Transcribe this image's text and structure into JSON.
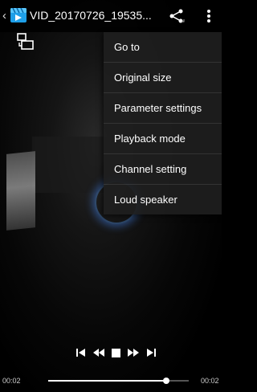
{
  "header": {
    "back_glyph": "‹",
    "title": "VID_20170726_19535..."
  },
  "menu": {
    "items": [
      "Go to",
      "Original size",
      "Parameter settings",
      "Playback mode",
      "Channel setting",
      "Loud speaker"
    ]
  },
  "player": {
    "current_time": "00:02",
    "total_time": "00:02",
    "progress": 0.84
  },
  "icons": {
    "back": "back-chevron-icon",
    "app": "video-app-icon",
    "share": "share-icon",
    "more": "more-vert-icon",
    "rotate": "screen-rotate-icon",
    "controls": [
      "skip-previous-icon",
      "rewind-icon",
      "stop-icon",
      "fast-forward-icon",
      "skip-next-icon"
    ]
  },
  "colors": {
    "menu_background": "#1e1e1e",
    "glow": "#5aa0ff"
  }
}
